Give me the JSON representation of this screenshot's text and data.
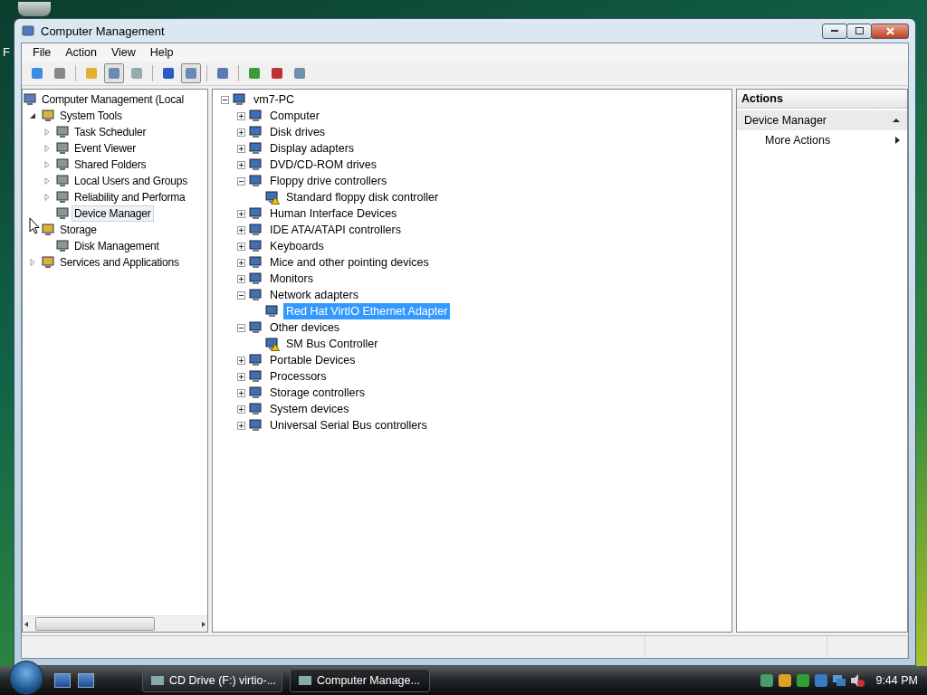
{
  "desktop": {
    "label": "F"
  },
  "window": {
    "title": "Computer Management"
  },
  "menu": [
    "File",
    "Action",
    "View",
    "Help"
  ],
  "nav_tree": [
    {
      "label": "Computer Management (Local",
      "selected": false,
      "children": [
        {
          "label": "System Tools",
          "expanded": true,
          "selected": false,
          "children": [
            {
              "label": "Task Scheduler",
              "expanded": false,
              "selected": false
            },
            {
              "label": "Event Viewer",
              "expanded": false,
              "selected": false
            },
            {
              "label": "Shared Folders",
              "expanded": false,
              "selected": false
            },
            {
              "label": "Local Users and Groups",
              "expanded": false,
              "selected": false
            },
            {
              "label": "Reliability and Performa",
              "expanded": false,
              "selected": false
            },
            {
              "label": "Device Manager",
              "selected": true
            }
          ]
        },
        {
          "label": "Storage",
          "selected": false,
          "children": [
            {
              "label": "Disk Management",
              "selected": false
            }
          ]
        },
        {
          "label": "Services and Applications",
          "expanded": false,
          "selected": false
        }
      ]
    }
  ],
  "device_tree": [
    {
      "label": "vm7-PC",
      "expanded": true,
      "selected": false,
      "warning": false,
      "children": [
        {
          "label": "Computer",
          "expanded": false,
          "selected": false,
          "warning": false
        },
        {
          "label": "Disk drives",
          "expanded": false,
          "selected": false,
          "warning": false
        },
        {
          "label": "Display adapters",
          "expanded": false,
          "selected": false,
          "warning": false
        },
        {
          "label": "DVD/CD-ROM drives",
          "expanded": false,
          "selected": false,
          "warning": false
        },
        {
          "label": "Floppy drive controllers",
          "expanded": true,
          "selected": false,
          "warning": false,
          "children": [
            {
              "label": "Standard floppy disk controller",
              "selected": false,
              "warning": true
            }
          ]
        },
        {
          "label": "Human Interface Devices",
          "expanded": false,
          "selected": false,
          "warning": false
        },
        {
          "label": "IDE ATA/ATAPI controllers",
          "expanded": false,
          "selected": false,
          "warning": false
        },
        {
          "label": "Keyboards",
          "expanded": false,
          "selected": false,
          "warning": false
        },
        {
          "label": "Mice and other pointing devices",
          "expanded": false,
          "selected": false,
          "warning": false
        },
        {
          "label": "Monitors",
          "expanded": false,
          "selected": false,
          "warning": false
        },
        {
          "label": "Network adapters",
          "expanded": true,
          "selected": false,
          "warning": false,
          "children": [
            {
              "label": "Red Hat VirtIO Ethernet Adapter",
              "selected": true,
              "warning": false
            }
          ]
        },
        {
          "label": "Other devices",
          "expanded": true,
          "selected": false,
          "warning": false,
          "children": [
            {
              "label": "SM Bus Controller",
              "selected": false,
              "warning": true
            }
          ]
        },
        {
          "label": "Portable Devices",
          "expanded": false,
          "selected": false,
          "warning": false
        },
        {
          "label": "Processors",
          "expanded": false,
          "selected": false,
          "warning": false
        },
        {
          "label": "Storage controllers",
          "expanded": false,
          "selected": false,
          "warning": false
        },
        {
          "label": "System devices",
          "expanded": false,
          "selected": false,
          "warning": false
        },
        {
          "label": "Universal Serial Bus controllers",
          "expanded": false,
          "selected": false,
          "warning": false
        }
      ]
    }
  ],
  "actions": {
    "title": "Actions",
    "section": {
      "label": "Device Manager",
      "expanded": true
    },
    "items": [
      "More Actions"
    ]
  },
  "taskbar": {
    "tasks": [
      {
        "label": "CD Drive (F:) virtio-...",
        "selected": false
      },
      {
        "label": "Computer Manage...",
        "selected": true
      }
    ],
    "clock": "9:44 PM"
  }
}
